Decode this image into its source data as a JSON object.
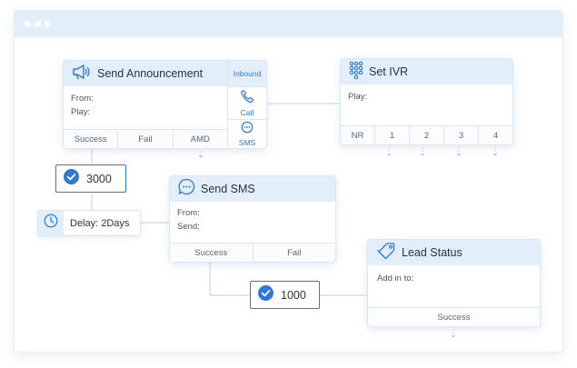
{
  "nodes": {
    "send_announcement": {
      "title": "Send Announcement",
      "fields": [
        "From:",
        "Play:"
      ],
      "outputs": [
        "Success",
        "Fail",
        "AMD"
      ],
      "triggers": [
        "Inbound",
        "Call",
        "SMS"
      ]
    },
    "set_ivr": {
      "title": "Set IVR",
      "fields": [
        "Play:"
      ],
      "outputs": [
        "NR",
        "1",
        "2",
        "3",
        "4"
      ]
    },
    "send_sms": {
      "title": "Send SMS",
      "fields": [
        "From:",
        "Send:"
      ],
      "outputs": [
        "Success",
        "Fail"
      ]
    },
    "lead_status": {
      "title": "Lead Status",
      "fields": [
        "Add in to:"
      ],
      "outputs": [
        "Success"
      ]
    }
  },
  "counters": [
    {
      "value": "3000"
    },
    {
      "value": "1000"
    }
  ],
  "delay": {
    "label": "Delay: 2Days"
  },
  "icons": {
    "megaphone": "megaphone-icon",
    "keypad": "keypad-icon",
    "chat": "chat-bubble-icon",
    "tag": "tag-icon",
    "check": "check-circle-icon",
    "clock": "clock-icon",
    "phone": "phone-icon"
  },
  "colors": {
    "accent": "#2f78d6",
    "header": "#e3eefb",
    "connector": "#c3cfdc"
  }
}
